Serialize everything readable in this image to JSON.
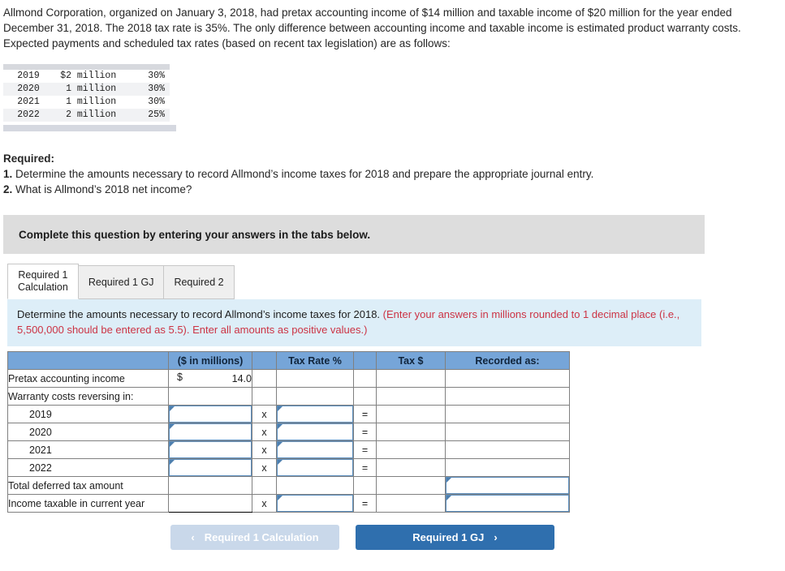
{
  "problem": {
    "stem": "Allmond Corporation, organized on January 3, 2018, had pretax accounting income of $14 million and taxable income of $20 million for the year ended December 31, 2018. The 2018 tax rate is 35%. The only difference between accounting income and taxable income is estimated product warranty costs. Expected payments and scheduled tax rates (based on recent tax legislation) are as follows:"
  },
  "facts_table": {
    "rows": [
      {
        "year": "2019",
        "amount": "$2 million",
        "rate": "30%"
      },
      {
        "year": "2020",
        "amount": "1 million",
        "rate": "30%"
      },
      {
        "year": "2021",
        "amount": "1 million",
        "rate": "30%"
      },
      {
        "year": "2022",
        "amount": "2 million",
        "rate": "25%"
      }
    ]
  },
  "required": {
    "heading": "Required:",
    "item1_num": "1.",
    "item1_text": " Determine the amounts necessary to record Allmond’s income taxes for 2018 and prepare the appropriate journal entry.",
    "item2_num": "2.",
    "item2_text": " What is Allmond’s 2018 net income?"
  },
  "grey_banner": {
    "text": "Complete this question by entering your answers in the tabs below."
  },
  "tabs": [
    {
      "label": "Required 1\nCalculation",
      "active": true
    },
    {
      "label": "Required 1 GJ",
      "active": false
    },
    {
      "label": "Required 2",
      "active": false
    }
  ],
  "blue_banner": {
    "black_text": "Determine the amounts necessary to record Allmond’s income taxes for 2018. ",
    "red_text": "(Enter your answers in millions rounded to 1 decimal place (i.e., 5,500,000 should be entered as 5.5). Enter all amounts as positive values.)"
  },
  "calc_table": {
    "headers": {
      "label": "",
      "millions": "($ in millions)",
      "x": "",
      "tax_rate": "Tax Rate %",
      "eq": "",
      "tax_dollars": "Tax $",
      "recorded_as": "Recorded as:"
    },
    "symbols": {
      "times": "x",
      "equals": "=",
      "currency": "$"
    },
    "rows": [
      {
        "label": "Pretax accounting income",
        "millions_value": "14.0",
        "show_currency": true
      },
      {
        "label": "Warranty costs reversing in:"
      },
      {
        "label": "2019",
        "indent": true
      },
      {
        "label": "2020",
        "indent": true
      },
      {
        "label": "2021",
        "indent": true
      },
      {
        "label": "2022",
        "indent": true
      },
      {
        "label": "Total deferred tax amount"
      },
      {
        "label": "Income taxable in current year"
      }
    ]
  },
  "nav": {
    "prev_label": "Required 1 Calculation",
    "prev_chevron": "‹",
    "next_label": "Required 1 GJ",
    "next_chevron": "›"
  },
  "colors": {
    "header_blue": "#76a5d8",
    "banner_blue": "#ddeef8",
    "banner_grey": "#dddddd",
    "red_text": "#cc3344",
    "button_blue": "#2f6fae",
    "button_disabled": "#c9d8ea",
    "input_border": "#5b8fc0"
  }
}
